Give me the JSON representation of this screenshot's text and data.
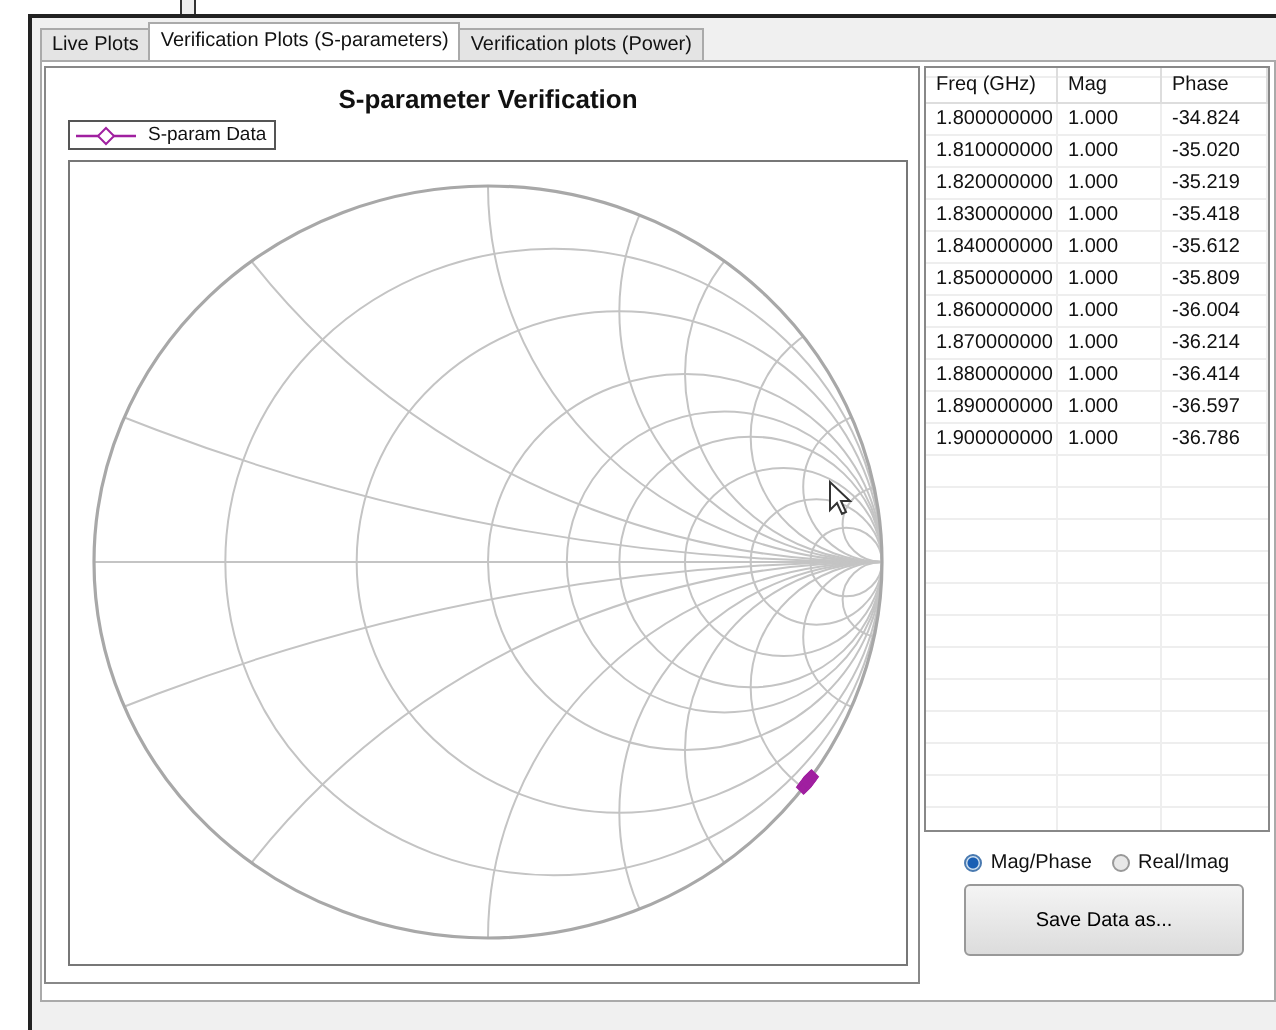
{
  "tabs": [
    {
      "label": "Live Plots",
      "selected": false
    },
    {
      "label": "Verification Plots (S-parameters)",
      "selected": true
    },
    {
      "label": "Verification plots (Power)",
      "selected": false
    }
  ],
  "chart": {
    "title": "S-parameter Verification",
    "legend": {
      "label": "S-param Data",
      "color": "#a020a0"
    }
  },
  "table": {
    "columns": [
      "Freq  (GHz)",
      "Mag",
      "Phase"
    ],
    "rows": [
      [
        "1.800000000",
        "1.000",
        "-34.824"
      ],
      [
        "1.810000000",
        "1.000",
        "-35.020"
      ],
      [
        "1.820000000",
        "1.000",
        "-35.219"
      ],
      [
        "1.830000000",
        "1.000",
        "-35.418"
      ],
      [
        "1.840000000",
        "1.000",
        "-35.612"
      ],
      [
        "1.850000000",
        "1.000",
        "-35.809"
      ],
      [
        "1.860000000",
        "1.000",
        "-36.004"
      ],
      [
        "1.870000000",
        "1.000",
        "-36.214"
      ],
      [
        "1.880000000",
        "1.000",
        "-36.414"
      ],
      [
        "1.890000000",
        "1.000",
        "-36.597"
      ],
      [
        "1.900000000",
        "1.000",
        "-36.786"
      ]
    ]
  },
  "format_options": [
    {
      "label": "Mag/Phase",
      "selected": true
    },
    {
      "label": "Real/Imag",
      "selected": false
    }
  ],
  "save_button": "Save Data as..."
}
